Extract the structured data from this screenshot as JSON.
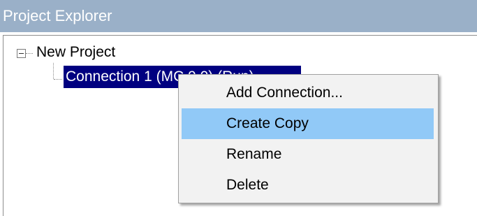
{
  "panel": {
    "title": "Project Explorer"
  },
  "tree": {
    "root_label": "New Project",
    "selected_label": "Connection 1 (MC 9.0) (Run)"
  },
  "context_menu": {
    "items": [
      {
        "label": "Add Connection..."
      },
      {
        "label": "Create Copy",
        "highlighted": true
      },
      {
        "label": "Rename"
      },
      {
        "label": "Delete"
      }
    ]
  },
  "colors": {
    "header_bg": "#9ab0c8",
    "selection_bg": "#000080",
    "menu_highlight": "#91c9f7",
    "menu_bg": "#f2f2f2"
  }
}
